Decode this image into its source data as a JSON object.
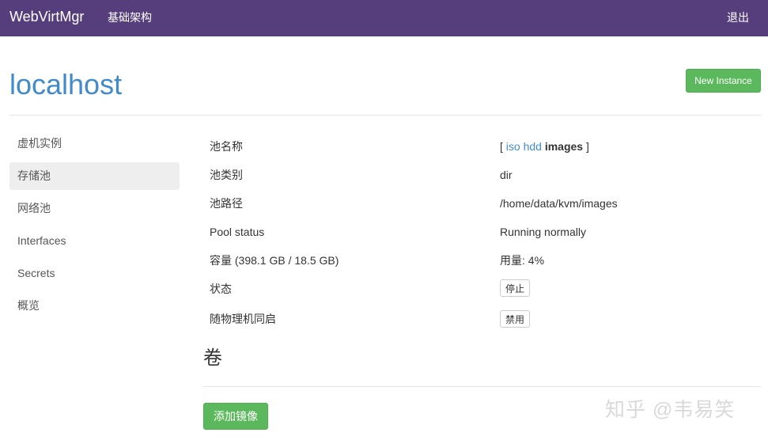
{
  "navbar": {
    "brand": "WebVirtMgr",
    "infrastructure_link": "基础架构",
    "logout_link": "退出",
    "background": "#563d7c"
  },
  "page": {
    "title": "localhost",
    "new_instance_button": "New Instance"
  },
  "sidebar": {
    "items": [
      {
        "label": "虚机实例",
        "active": false
      },
      {
        "label": "存储池",
        "active": true
      },
      {
        "label": "网络池",
        "active": false
      },
      {
        "label": "Interfaces",
        "active": false
      },
      {
        "label": "Secrets",
        "active": false
      },
      {
        "label": "概览",
        "active": false
      }
    ]
  },
  "pool_info": {
    "name": {
      "label": "池名称",
      "bracket_open": "[",
      "pools": [
        "iso",
        "hdd"
      ],
      "active_pool": "images",
      "bracket_close": "]"
    },
    "type": {
      "label": "池类别",
      "value": "dir"
    },
    "path": {
      "label": "池路径",
      "value": "/home/data/kvm/images"
    },
    "status": {
      "label": "Pool status",
      "value": "Running normally"
    },
    "capacity": {
      "label": "容量 (398.1 GB / 18.5 GB)",
      "value": "用量: 4%"
    },
    "state": {
      "label": "状态",
      "button": "停止"
    },
    "autostart": {
      "label": "随物理机同启",
      "button": "禁用"
    }
  },
  "volumes": {
    "title": "卷",
    "add_image_button": "添加镜像"
  },
  "watermark": "知乎 @韦易笑",
  "colors": {
    "accent_link": "#428bca",
    "success": "#5cb85c",
    "active_bg": "#eeeeee"
  }
}
